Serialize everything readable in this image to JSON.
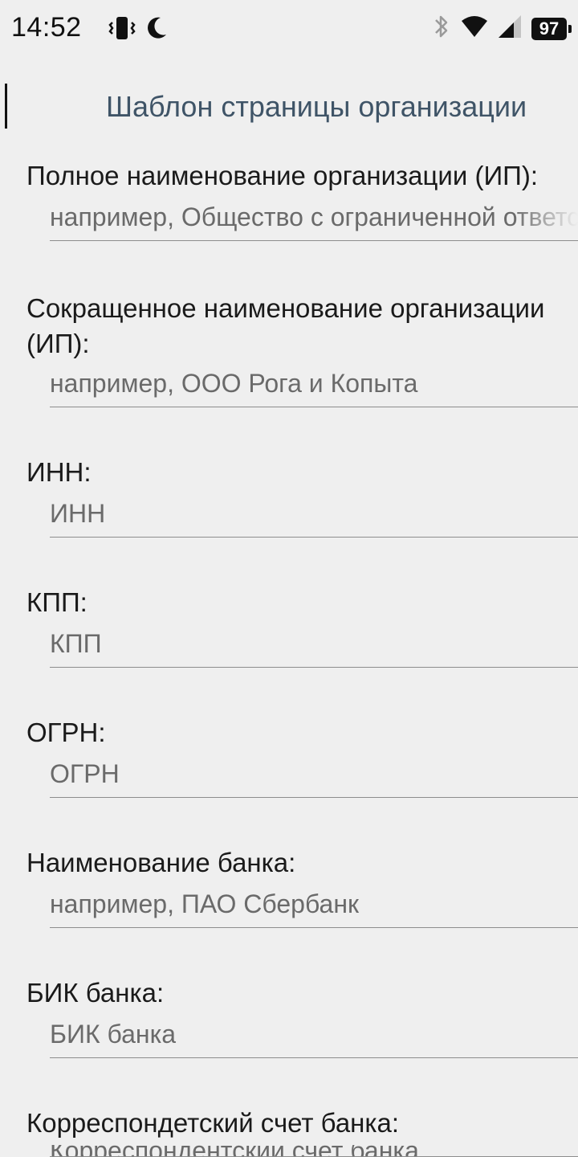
{
  "status_bar": {
    "time": "14:52",
    "battery": "97",
    "left_icons": [
      "vibrate-icon",
      "moon-icon"
    ],
    "right_icons": [
      "bluetooth-icon",
      "wifi-icon",
      "signal-icon",
      "battery-icon"
    ]
  },
  "page": {
    "title": "Шаблон страницы организации"
  },
  "form": {
    "fields": [
      {
        "label": "Полное наименование организации (ИП):",
        "placeholder": "например, Общество с ограниченной ответственностью",
        "value": ""
      },
      {
        "label": "Сокращенное наименование организации (ИП):",
        "placeholder": "например, ООО Рога и Копыта",
        "value": ""
      },
      {
        "label": "ИНН:",
        "placeholder": "ИНН",
        "value": ""
      },
      {
        "label": "КПП:",
        "placeholder": "КПП",
        "value": ""
      },
      {
        "label": "ОГРН:",
        "placeholder": "ОГРН",
        "value": ""
      },
      {
        "label": "Наименование банка:",
        "placeholder": "например, ПАО Сбербанк",
        "value": ""
      },
      {
        "label": "БИК банка:",
        "placeholder": "БИК банка",
        "value": ""
      },
      {
        "label": "Корреспондетский счет банка:",
        "placeholder": "Корреспондентский счет банка",
        "value": ""
      }
    ]
  },
  "colors": {
    "background": "#efefef",
    "title": "#3f5467",
    "label": "#1a1a1a",
    "placeholder": "#6a6a6a",
    "underline": "#8d8d8d"
  }
}
